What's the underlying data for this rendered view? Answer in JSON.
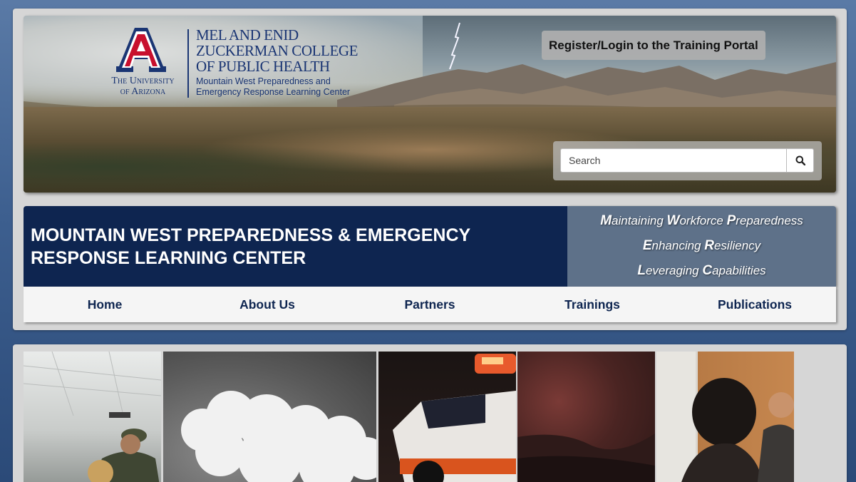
{
  "logo": {
    "university_line1": "The University",
    "university_line2": "of Arizona",
    "college_name": "Mel and Enid Zuckerman College of Public Health",
    "center_name": "Mountain West Preparedness and Emergency Response Learning Center"
  },
  "portal_button": "Register/Login to the Training Portal",
  "search": {
    "placeholder": "Search"
  },
  "site_title": "MOUNTAIN WEST PREPAREDNESS & EMERGENCY RESPONSE LEARNING CENTER",
  "taglines": [
    {
      "w1_cap": "M",
      "w1_rest": "aintaining ",
      "w2_cap": "W",
      "w2_rest": "orkforce ",
      "w3_cap": "P",
      "w3_rest": "reparedness"
    },
    {
      "w1_cap": "E",
      "w1_rest": "nhancing ",
      "w2_cap": "R",
      "w2_rest": "esiliency"
    },
    {
      "w1_cap": "L",
      "w1_rest": "everaging ",
      "w2_cap": "C",
      "w2_rest": "apabilities"
    }
  ],
  "nav": [
    "Home",
    "About Us",
    "Partners",
    "Trainings",
    "Publications"
  ],
  "colors": {
    "navy": "#0e2550",
    "tagline_bg": "#5e7189",
    "logo_blue": "#1a3573",
    "logo_red": "#c8102e"
  }
}
